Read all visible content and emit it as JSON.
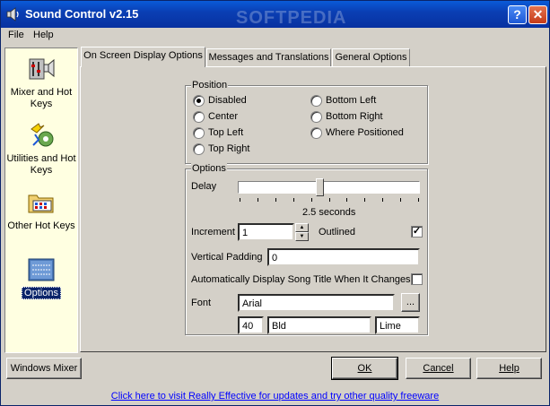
{
  "window": {
    "title": "Sound Control v2.15",
    "watermark": "SOFTPEDIA"
  },
  "menu": {
    "file": "File",
    "help": "Help"
  },
  "sidebar": {
    "items": [
      {
        "label": "Mixer and Hot Keys"
      },
      {
        "label": "Utilities and Hot Keys"
      },
      {
        "label": "Other Hot Keys"
      },
      {
        "label": "Options"
      }
    ],
    "windows_mixer": "Windows Mixer"
  },
  "tabs": [
    {
      "label": "On Screen Display Options"
    },
    {
      "label": "Messages and Translations"
    },
    {
      "label": "General Options"
    }
  ],
  "position": {
    "title": "Position",
    "options": [
      "Disabled",
      "Center",
      "Top Left",
      "Top Right",
      "Bottom Left",
      "Bottom Right",
      "Where Positioned"
    ],
    "selected": "Disabled"
  },
  "options": {
    "title": "Options",
    "delay_label": "Delay",
    "delay_value": "2.5 seconds",
    "delay_fraction": 0.45,
    "increment_label": "Increment",
    "increment_value": "1",
    "outlined_label": "Outlined",
    "outlined_checked": true,
    "vpad_label": "Vertical Padding",
    "vpad_value": "0",
    "auto_display_label": "Automatically Display Song Title When It Changes",
    "auto_display_checked": false,
    "font_label": "Font",
    "font_name": "Arial",
    "font_browse": "...",
    "font_size": "40",
    "font_style": "Bld",
    "font_color": "Lime"
  },
  "buttons": {
    "ok": "OK",
    "cancel": "Cancel",
    "help": "Help"
  },
  "footer": {
    "link": "Click here to visit Really Effective for updates and try other quality freeware"
  }
}
